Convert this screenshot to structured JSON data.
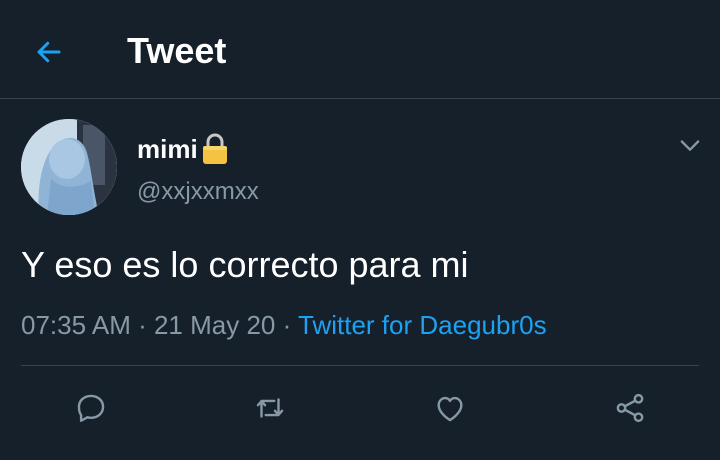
{
  "header": {
    "back_icon": "arrow-left-icon",
    "title": "Tweet"
  },
  "tweet": {
    "author_name": "mimi",
    "lock_icon": "lock-icon",
    "handle": "@xxjxxmxx",
    "text": "Y eso es lo correcto para mi",
    "time": "07:35 AM",
    "separator": " · ",
    "date": "21 May 20",
    "source": "Twitter for Daegubr0s"
  },
  "actions": [
    "reply-icon",
    "retweet-icon",
    "like-icon",
    "share-icon"
  ],
  "colors": {
    "background": "#15202b",
    "accent": "#1da1f2",
    "secondary_text": "#8899a6",
    "divider": "#38444d",
    "lock": "#f5c242"
  }
}
